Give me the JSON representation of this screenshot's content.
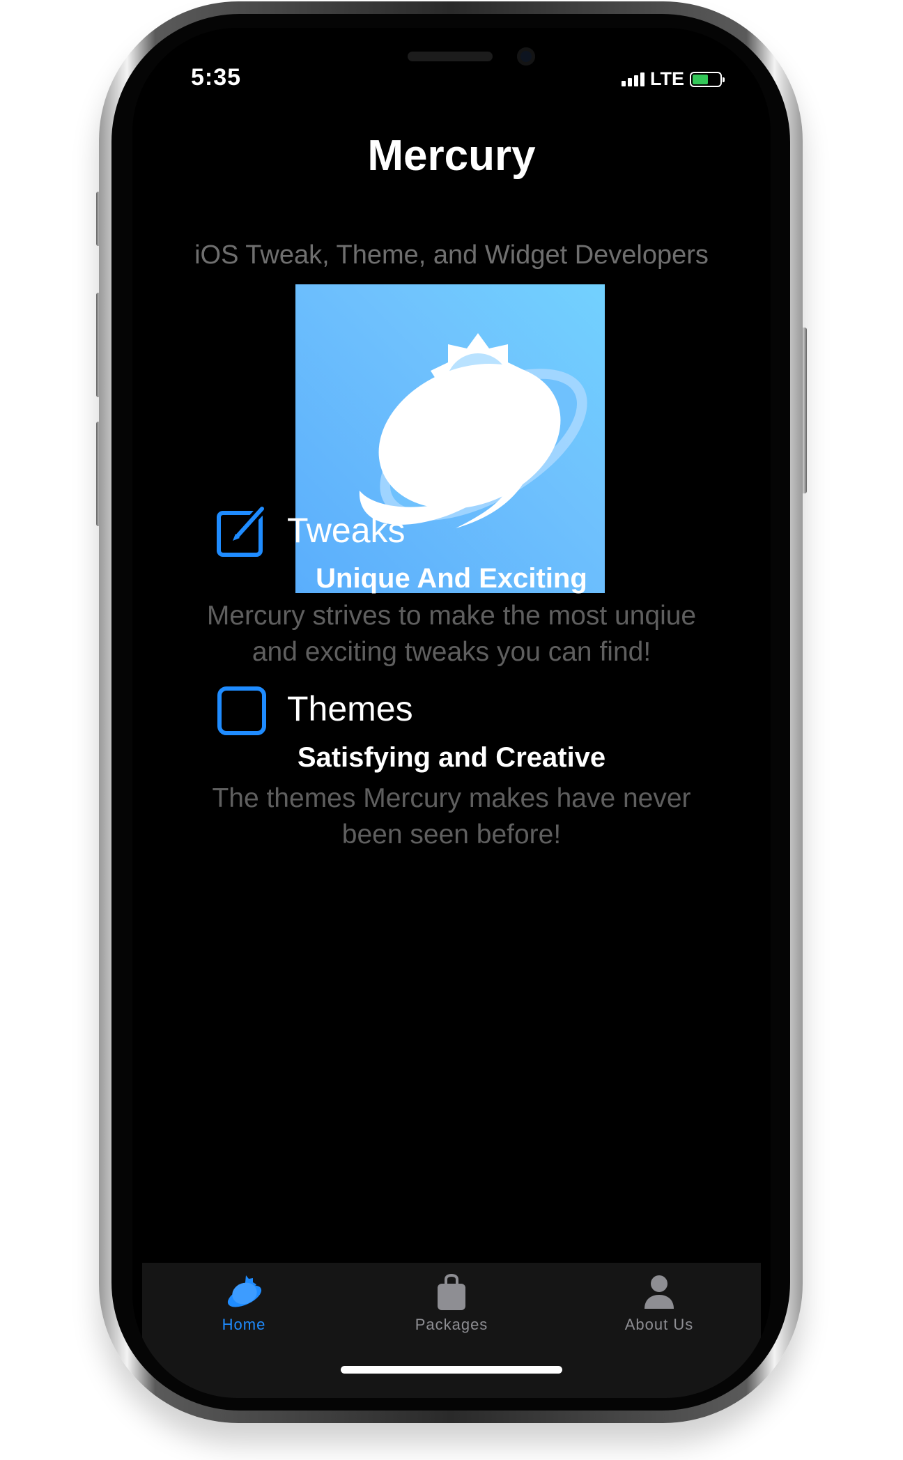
{
  "status_bar": {
    "time": "5:35",
    "network": "LTE",
    "battery_color": "#34c759"
  },
  "header": {
    "title": "Mercury",
    "subtitle": "iOS Tweak, Theme, and Widget Developers"
  },
  "logo": {
    "icon": "planet-logo-icon",
    "background": "#6fc1fd"
  },
  "features": [
    {
      "icon": "edit-square-icon",
      "label": "Tweaks",
      "heading": "Unique And Exciting",
      "description": "Mercury strives to make the most unqiue and exciting tweaks you can find!"
    },
    {
      "icon": "square-outline-icon",
      "label": "Themes",
      "heading": "Satisfying and Creative",
      "description": "The themes Mercury makes have never been seen before!"
    }
  ],
  "tab_bar": {
    "active_color": "#1f8cff",
    "inactive_color": "#8e8e93",
    "items": [
      {
        "label": "Home",
        "icon": "planet-icon",
        "active": true
      },
      {
        "label": "Packages",
        "icon": "bag-icon",
        "active": false
      },
      {
        "label": "About Us",
        "icon": "person-icon",
        "active": false
      }
    ]
  },
  "colors": {
    "accent": "#1f8cff",
    "background": "#000000"
  }
}
